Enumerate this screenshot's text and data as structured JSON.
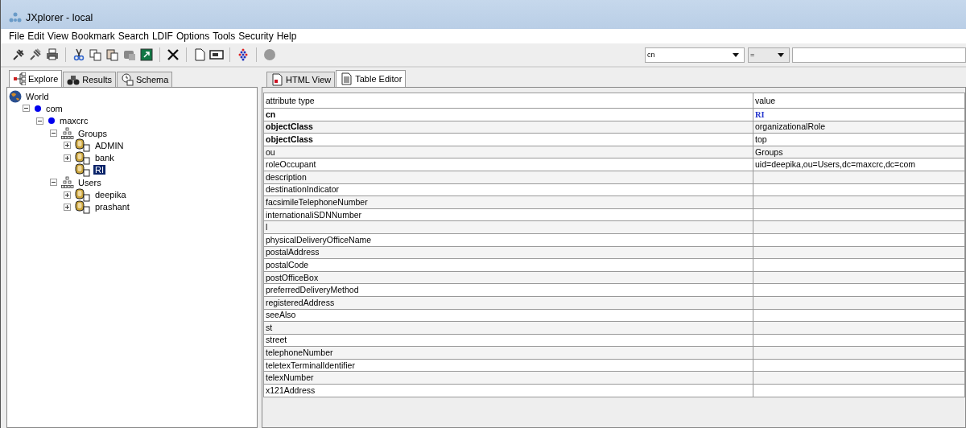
{
  "window": {
    "title": "JXplorer - local"
  },
  "menu": [
    "File",
    "Edit",
    "View",
    "Bookmark",
    "Search",
    "LDIF",
    "Options",
    "Tools",
    "Security",
    "Help"
  ],
  "search": {
    "attribute": "cn",
    "operator": "="
  },
  "left_tabs": [
    {
      "label": "Explore",
      "selected": true
    },
    {
      "label": "Results",
      "selected": false
    },
    {
      "label": "Schema",
      "selected": false
    }
  ],
  "tree": [
    {
      "label": "World",
      "kind": "root",
      "selected": false,
      "children": [
        {
          "label": "com",
          "kind": "dc",
          "expanded": true,
          "selected": false,
          "children": [
            {
              "label": "maxcrc",
              "kind": "dc",
              "expanded": true,
              "selected": false,
              "children": [
                {
                  "label": "Groups",
                  "kind": "ou",
                  "expanded": true,
                  "selected": false,
                  "children": [
                    {
                      "label": "ADMIN",
                      "kind": "person",
                      "expanded": false,
                      "selected": false
                    },
                    {
                      "label": "bank",
                      "kind": "person",
                      "expanded": false,
                      "selected": false
                    },
                    {
                      "label": "RI",
                      "kind": "person",
                      "selected": true
                    }
                  ]
                },
                {
                  "label": "Users",
                  "kind": "ou",
                  "expanded": true,
                  "selected": false,
                  "children": [
                    {
                      "label": "deepika",
                      "kind": "person",
                      "expanded": false,
                      "selected": false
                    },
                    {
                      "label": "prashant",
                      "kind": "person",
                      "expanded": false,
                      "selected": false
                    }
                  ]
                }
              ]
            }
          ]
        }
      ]
    }
  ],
  "right_tabs": [
    {
      "label": "HTML View",
      "selected": false
    },
    {
      "label": "Table Editor",
      "selected": true
    }
  ],
  "table": {
    "columns": [
      "attribute type",
      "value"
    ],
    "rows": [
      {
        "attribute": "cn",
        "required": true,
        "value": "RI",
        "naming": true
      },
      {
        "attribute": "objectClass",
        "required": true,
        "value": "organizationalRole",
        "naming": false
      },
      {
        "attribute": "objectClass",
        "required": true,
        "value": "top",
        "naming": false
      },
      {
        "attribute": "ou",
        "required": false,
        "value": "Groups",
        "naming": false
      },
      {
        "attribute": "roleOccupant",
        "required": false,
        "value": "uid=deepika,ou=Users,dc=maxcrc,dc=com",
        "naming": false
      },
      {
        "attribute": "description",
        "required": false
      },
      {
        "attribute": "destinationIndicator",
        "required": false
      },
      {
        "attribute": "facsimileTelephoneNumber",
        "required": false
      },
      {
        "attribute": "internationaliSDNNumber",
        "required": false
      },
      {
        "attribute": "l",
        "required": false
      },
      {
        "attribute": "physicalDeliveryOfficeName",
        "required": false
      },
      {
        "attribute": "postalAddress",
        "required": false
      },
      {
        "attribute": "postalCode",
        "required": false
      },
      {
        "attribute": "postOfficeBox",
        "required": false
      },
      {
        "attribute": "preferredDeliveryMethod",
        "required": false
      },
      {
        "attribute": "registeredAddress",
        "required": false
      },
      {
        "attribute": "seeAlso",
        "required": false
      },
      {
        "attribute": "st",
        "required": false
      },
      {
        "attribute": "street",
        "required": false
      },
      {
        "attribute": "telephoneNumber",
        "required": false
      },
      {
        "attribute": "teletexTerminalIdentifier",
        "required": false
      },
      {
        "attribute": "telexNumber",
        "required": false
      },
      {
        "attribute": "x121Address",
        "required": false
      }
    ]
  }
}
